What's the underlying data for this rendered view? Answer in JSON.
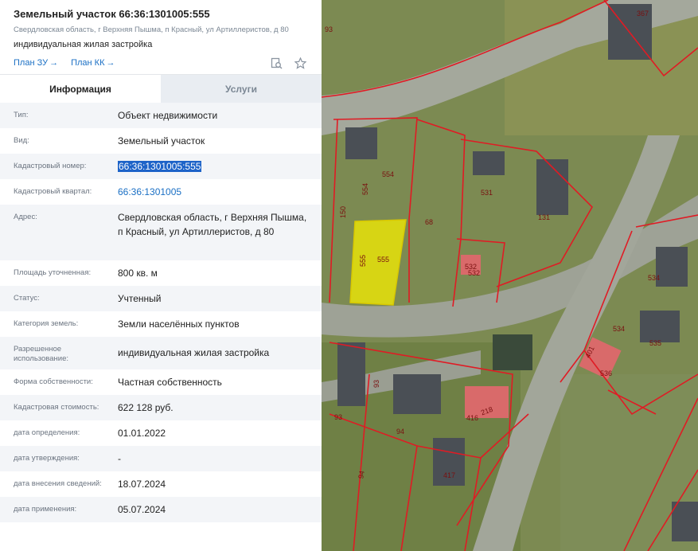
{
  "header": {
    "title": "Земельный участок 66:36:1301005:555",
    "address": "Свердловская область, г Верхняя Пышма, п Красный, ул Артиллеристов, д 80",
    "use": "индивидуальная жилая застройка",
    "links": [
      "План ЗУ",
      "План КК"
    ]
  },
  "icons": {
    "search": "search-doc-icon",
    "star": "star-icon",
    "arrow": "arrow-right-icon"
  },
  "tabs": [
    {
      "label": "Информация",
      "active": true
    },
    {
      "label": "Услуги",
      "active": false
    }
  ],
  "info": [
    {
      "label": "Тип:",
      "value": "Объект недвижимости"
    },
    {
      "label": "Вид:",
      "value": "Земельный участок"
    },
    {
      "label": "Кадастровый номер:",
      "value": "66:36:1301005:555"
    },
    {
      "label": "Кадастровый квартал:",
      "value": "66:36:1301005"
    },
    {
      "label": "Адрес:",
      "value": "Свердловская область, г Верхняя Пышма, п Красный, ул Артиллеристов, д 80"
    },
    {
      "label": "Площадь уточненная:",
      "value": "800 кв. м"
    },
    {
      "label": "Статус:",
      "value": "Учтенный"
    },
    {
      "label": "Категория земель:",
      "value": "Земли населённых пунктов"
    },
    {
      "label": "Разрешенное использование:",
      "value": "индивидуальная жилая застройка"
    },
    {
      "label": "Форма собственности:",
      "value": "Частная собственность"
    },
    {
      "label": "Кадастровая стоимость:",
      "value": "622 128 руб."
    },
    {
      "label": "дата определения:",
      "value": "01.01.2022"
    },
    {
      "label": "дата утверждения:",
      "value": "-"
    },
    {
      "label": "дата внесения сведений:",
      "value": "18.07.2024"
    },
    {
      "label": "дата применения:",
      "value": "05.07.2024"
    }
  ],
  "map": {
    "parcel_labels": [
      "367",
      "93",
      "554",
      "554",
      "531",
      "131",
      "150",
      "555",
      "555",
      "68",
      "532",
      "532",
      "534",
      "534",
      "535",
      "401",
      "536",
      "93",
      "416",
      "218",
      "94",
      "93",
      "94",
      "417"
    ],
    "colors": {
      "boundary": "#e01b24",
      "selected": "#f5ee00",
      "road": "#9aa096"
    }
  }
}
